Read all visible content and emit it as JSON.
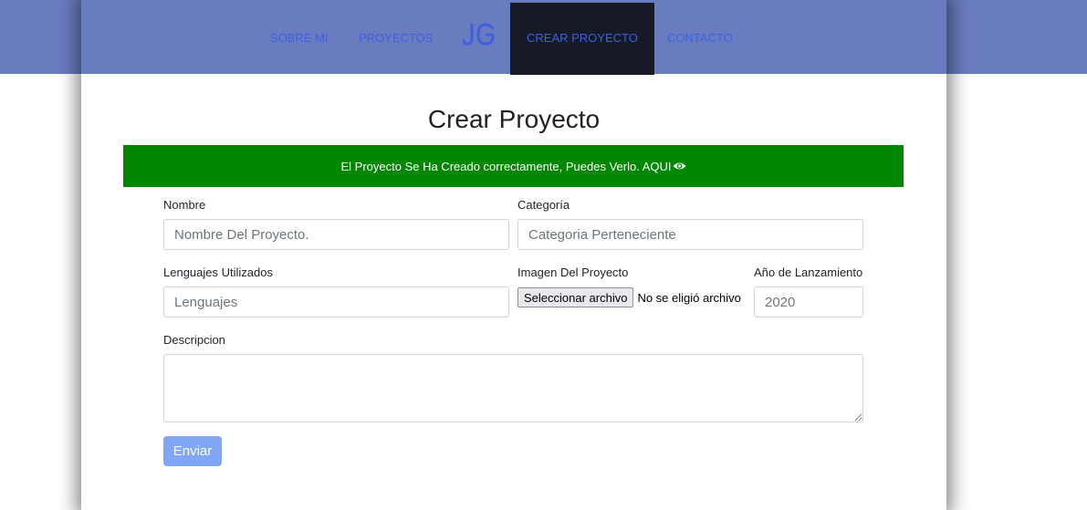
{
  "nav": {
    "items": [
      {
        "label": "SOBRE MI"
      },
      {
        "label": "PROYECTOS"
      },
      {
        "label": "CREAR PROYECTO"
      },
      {
        "label": "CONTACTO"
      }
    ],
    "logo_text": "JG"
  },
  "page": {
    "title": "Crear Proyecto"
  },
  "alert": {
    "text": "El Proyecto Se Ha Creado correctamente, Puedes Verlo. AQUI",
    "icon": "eye-icon"
  },
  "form": {
    "nombre": {
      "label": "Nombre",
      "placeholder": "Nombre Del Proyecto.",
      "value": ""
    },
    "categoria": {
      "label": "Categoría",
      "placeholder": "Categoria Perteneciente",
      "value": ""
    },
    "lenguajes": {
      "label": "Lenguajes Utilizados",
      "placeholder": "Lenguajes",
      "value": ""
    },
    "imagen": {
      "label": "Imagen Del Proyecto",
      "button": "Seleccionar archivo",
      "status": "No se eligió archivo"
    },
    "anio": {
      "label": "Año de Lanzamiento",
      "placeholder": "2020",
      "value": ""
    },
    "descripcion": {
      "label": "Descripcion",
      "value": ""
    },
    "submit": "Enviar"
  },
  "colors": {
    "navbar": "#6a7cc0",
    "nav_text": "#3f5fe0",
    "active_nav": "#151a26",
    "alert_bg": "#028702",
    "submit_bg": "#80a6f4"
  }
}
